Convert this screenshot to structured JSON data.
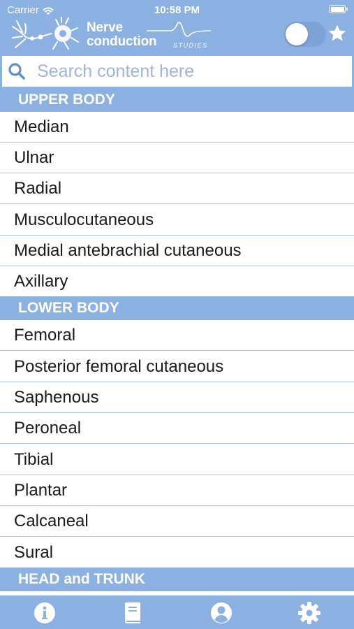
{
  "status_bar": {
    "carrier": "Carrier",
    "time": "10:58 PM"
  },
  "header": {
    "logo_line1": "Nerve",
    "logo_line2": "conduction",
    "logo_sub": "STUDIES",
    "toggle_on": false,
    "favorite_icon": "star-icon"
  },
  "search": {
    "placeholder": "Search content here",
    "value": "",
    "icon": "search-icon"
  },
  "sections": {
    "upper": {
      "title": "UPPER BODY",
      "items": [
        "Median",
        "Ulnar",
        "Radial",
        "Musculocutaneous",
        "Medial antebrachial cutaneous",
        "Axillary"
      ]
    },
    "lower": {
      "title": "LOWER BODY",
      "items": [
        "Femoral",
        "Posterior femoral cutaneous",
        "Saphenous",
        "Peroneal",
        "Tibial",
        "Plantar",
        "Calcaneal",
        "Sural"
      ]
    },
    "head": {
      "title": "HEAD and TRUNK"
    }
  },
  "tabbar": {
    "tabs": [
      "info-icon",
      "book-icon",
      "profile-icon",
      "settings-icon"
    ]
  },
  "colors": {
    "primary": "#8bb0e2",
    "text": "#1a1a1a",
    "divider": "#a9bfe0",
    "placeholder": "#9db6d8"
  }
}
